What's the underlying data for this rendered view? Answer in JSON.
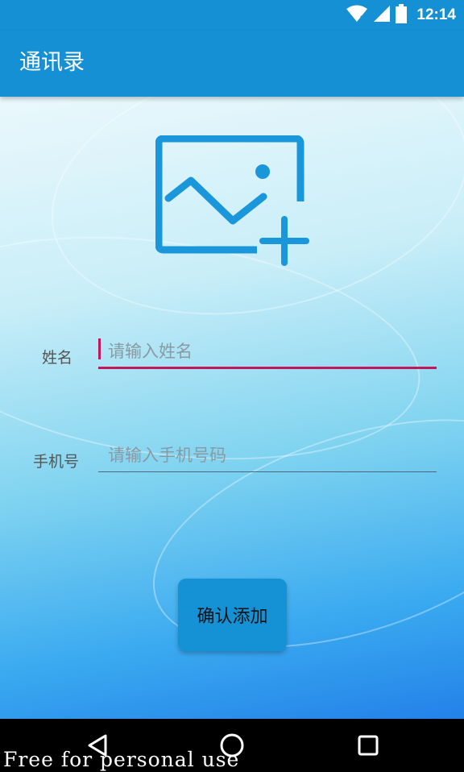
{
  "status_bar": {
    "time": "12:14",
    "icons": [
      "wifi-icon",
      "signal-icon",
      "battery-icon"
    ]
  },
  "app_bar": {
    "title": "通讯录"
  },
  "avatar_picker": {
    "icon": "add-image-icon"
  },
  "form": {
    "name": {
      "label": "姓名",
      "placeholder": "请输入姓名",
      "value": ""
    },
    "phone": {
      "label": "手机号",
      "placeholder": "请输入手机号码",
      "value": ""
    }
  },
  "confirm_button": {
    "label": "确认添加"
  },
  "nav_bar": {
    "icons": [
      "back-icon",
      "home-icon",
      "recents-icon"
    ]
  },
  "watermark": "Free for personal use",
  "colors": {
    "primary": "#1590d4",
    "accent": "#c2185b",
    "icon_blue": "#1a96da"
  }
}
